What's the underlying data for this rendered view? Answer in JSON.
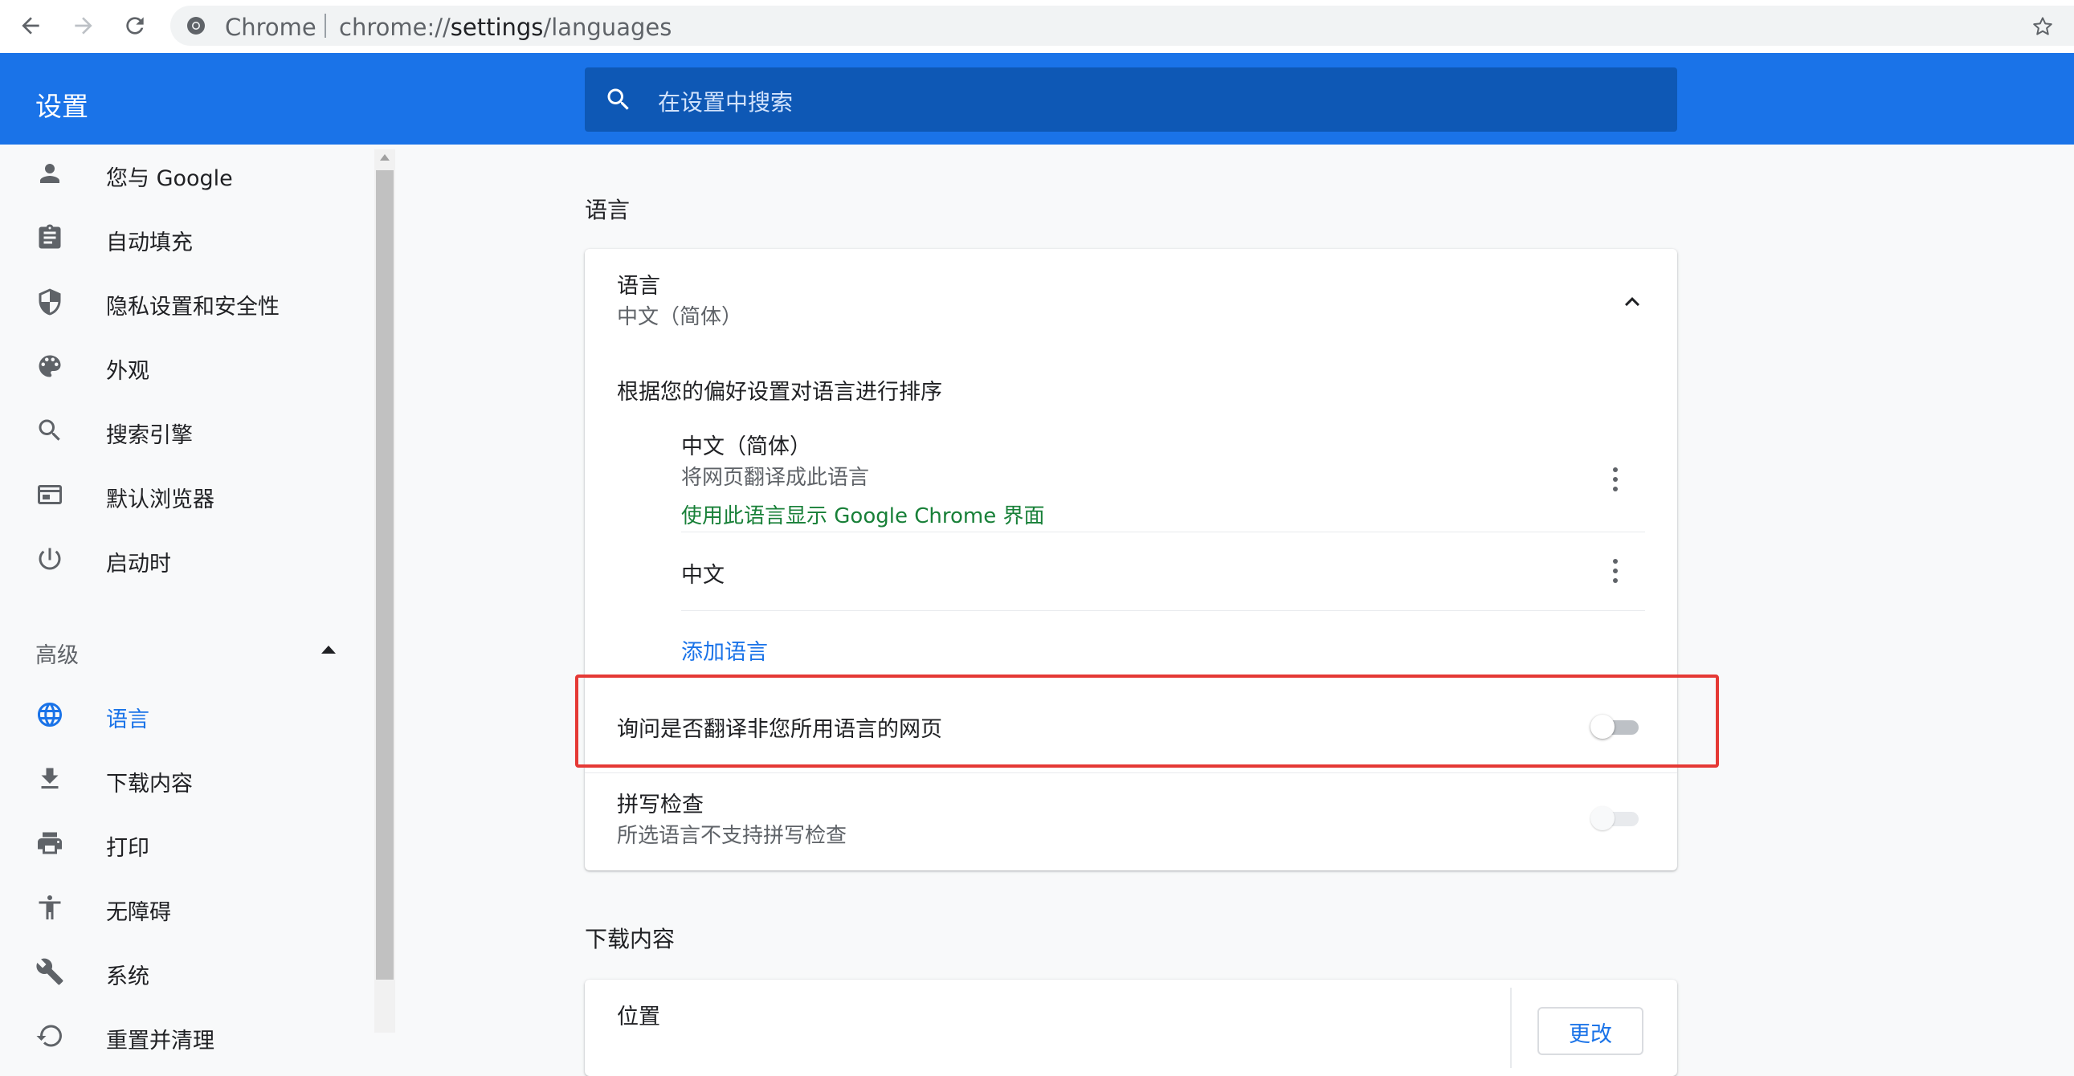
{
  "browser": {
    "site_name": "Chrome",
    "url_prefix": "chrome://",
    "url_host": "settings",
    "url_path": "/languages"
  },
  "header": {
    "title": "设置",
    "search_placeholder": "在设置中搜索"
  },
  "sidebar": {
    "items": [
      {
        "label": "您与 Google",
        "icon": "person-icon"
      },
      {
        "label": "自动填充",
        "icon": "clipboard-icon"
      },
      {
        "label": "隐私设置和安全性",
        "icon": "shield-icon"
      },
      {
        "label": "外观",
        "icon": "palette-icon"
      },
      {
        "label": "搜索引擎",
        "icon": "search-icon"
      },
      {
        "label": "默认浏览器",
        "icon": "browser-icon"
      },
      {
        "label": "启动时",
        "icon": "power-icon"
      }
    ],
    "advanced_label": "高级",
    "advanced_items": [
      {
        "label": "语言",
        "icon": "globe-icon",
        "active": true
      },
      {
        "label": "下载内容",
        "icon": "download-icon"
      },
      {
        "label": "打印",
        "icon": "printer-icon"
      },
      {
        "label": "无障碍",
        "icon": "accessibility-icon"
      },
      {
        "label": "系统",
        "icon": "wrench-icon"
      },
      {
        "label": "重置并清理",
        "icon": "reset-icon"
      }
    ]
  },
  "languages_section": {
    "title": "语言",
    "header_label": "语言",
    "header_value": "中文（简体）",
    "order_hint": "根据您的偏好设置对语言进行排序",
    "languages": [
      {
        "name": "中文（简体）",
        "sub": "将网页翻译成此语言",
        "note": "使用此语言显示 Google Chrome 界面"
      },
      {
        "name": "中文"
      }
    ],
    "add_language": "添加语言",
    "translate_offer": {
      "label": "询问是否翻译非您所用语言的网页",
      "enabled": false
    },
    "spellcheck": {
      "label": "拼写检查",
      "sub": "所选语言不支持拼写检查",
      "enabled": false
    }
  },
  "downloads_section": {
    "title": "下载内容",
    "location_label": "位置",
    "change_button": "更改"
  },
  "colors": {
    "accent": "#1a73e8",
    "highlight_border": "#e53935",
    "green_note": "#188038"
  }
}
